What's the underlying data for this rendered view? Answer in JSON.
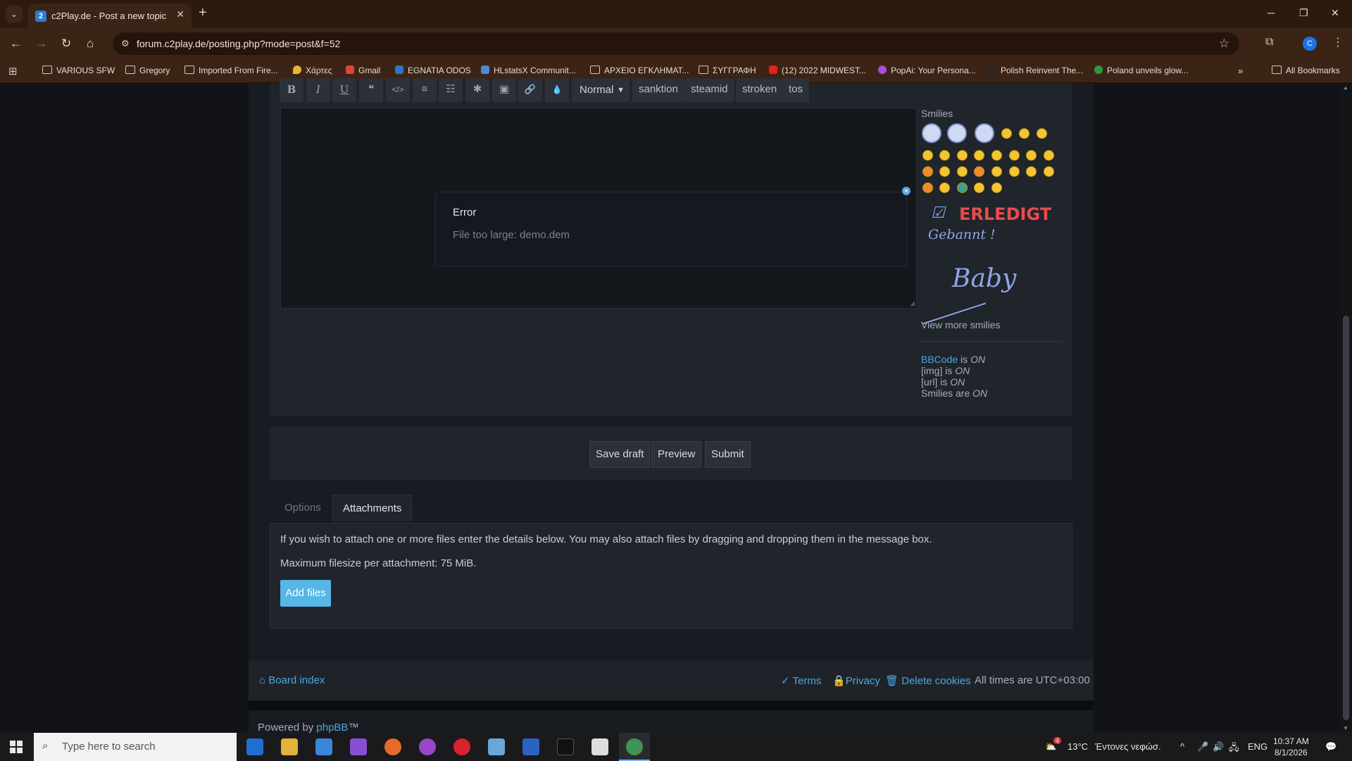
{
  "browser": {
    "tab_title": "c2Play.de - Post a new topic",
    "tab_favicon": "2",
    "url": "forum.c2play.de/posting.php?mode=post&f=52",
    "profile_initial": "C",
    "bookmarks": [
      "VARIOUS SFW",
      "Gregory",
      "Imported From Fire...",
      "Χάρτες",
      "Gmail",
      "EGNATIA ODOS",
      "HLstatsX Communit...",
      "ΑΡΧΕΙΟ ΕΓΚΛΗΜΑΤ...",
      "ΣΥΓΓΡΑΦΗ",
      "(12) 2022 MIDWEST...",
      "PopAi: Your Persona...",
      "Polish Reinvent The...",
      "Poland unveils glow..."
    ],
    "all_bookmarks": "All Bookmarks"
  },
  "editor": {
    "format_buttons": [
      "B",
      "I",
      "U",
      "❝",
      "</>",
      "≡",
      "☷",
      "✱",
      "▣",
      "🔗",
      "💧"
    ],
    "font_size": "Normal",
    "bbcode_tags": [
      "sanktion",
      "steamid",
      "stroken",
      "tos"
    ]
  },
  "error": {
    "title": "Error",
    "message": "File too large: demo.dem"
  },
  "smilies": {
    "label": "Smilies",
    "sticker_erledigt": "ERLEDIGT",
    "sticker_gebannt": "Gebannt !",
    "sticker_baby": "Baby",
    "view_more": "View more smilies"
  },
  "status": {
    "bbcode_link": "BBCode",
    "bbcode_rest": "is",
    "bbcode_state": "ON",
    "img_label": "[img] is",
    "img_state": "ON",
    "url_label": "[url] is",
    "url_state": "ON",
    "smilies_label": "Smilies are",
    "smilies_state": "ON"
  },
  "actions": {
    "save_draft": "Save draft",
    "preview": "Preview",
    "submit": "Submit"
  },
  "tabs": {
    "options": "Options",
    "attachments": "Attachments"
  },
  "attachments": {
    "info": "If you wish to attach one or more files enter the details below. You may also attach files by dragging and dropping them in the message box.",
    "max_size": "Maximum filesize per attachment: 75 MiB.",
    "add_files": "Add files"
  },
  "footer": {
    "board_index": "Board index",
    "terms": "Terms",
    "privacy": "Privacy",
    "delete_cookies": "Delete cookies",
    "timezone": "All times are UTC+03:00",
    "powered_by": "Powered by",
    "phpbb": "phpBB",
    "tm": "™"
  },
  "taskbar": {
    "search_placeholder": "Type here to search",
    "temperature": "13°C",
    "weather": "Έντονες νεφώσ.",
    "language": "ENG",
    "time": "10:37 AM",
    "date": "8/1/2026",
    "notification_count": "4"
  }
}
